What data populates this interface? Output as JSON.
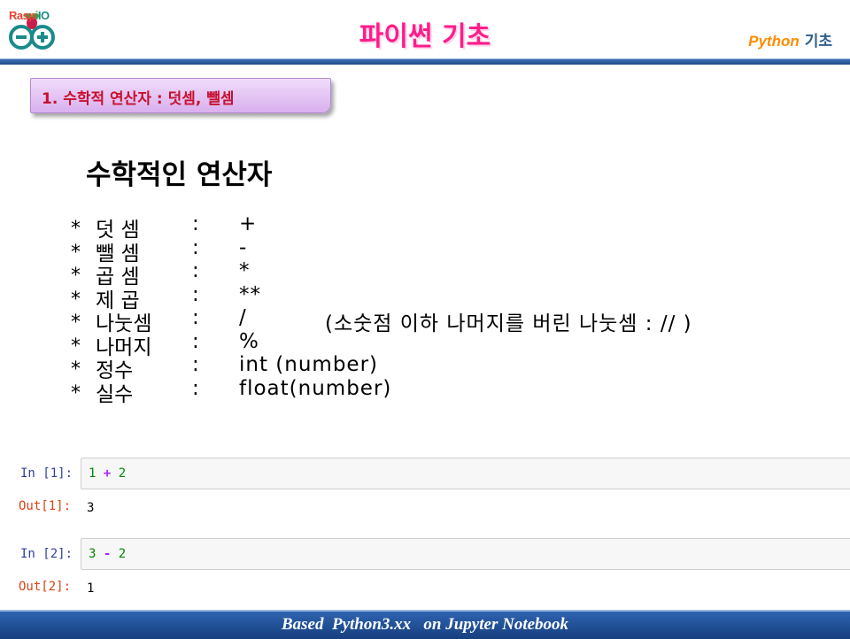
{
  "header": {
    "logo_text_a": "Rasp",
    "logo_text_b": "i",
    "logo_text_c": "IO",
    "title": "파이썬 기초",
    "subtitle_en": "Python",
    "subtitle_ko": "기초"
  },
  "section": {
    "label": "1. 수학적 연산자 : 덧셈, 뺄셈"
  },
  "content": {
    "heading": "수학적인 연산자",
    "operators": [
      {
        "bullet": "*",
        "name": "덧 셈",
        "colon": ":",
        "symbol": "+",
        "note": ""
      },
      {
        "bullet": "*",
        "name": "뺄 셈",
        "colon": ":",
        "symbol": "-",
        "note": ""
      },
      {
        "bullet": "*",
        "name": "곱 셈",
        "colon": ":",
        "symbol": "*",
        "note": ""
      },
      {
        "bullet": "*",
        "name": "제 곱",
        "colon": ":",
        "symbol": "**",
        "note": ""
      },
      {
        "bullet": "*",
        "name": "나눗셈",
        "colon": ":",
        "symbol": "/",
        "note": "(소숫점 이하 나머지를 버린 나눗셈 :  // )"
      },
      {
        "bullet": "*",
        "name": "나머지",
        "colon": ":",
        "symbol": "%",
        "note": ""
      },
      {
        "bullet": "*",
        "name": "정수",
        "colon": ":",
        "symbol": "int (number)",
        "note": ""
      },
      {
        "bullet": "*",
        "name": "실수",
        "colon": ":",
        "symbol": "float(number)",
        "note": ""
      }
    ]
  },
  "notebook": {
    "cells": [
      {
        "in_prompt": "In [1]:",
        "code_a": "1",
        "code_op": "+",
        "code_b": "2",
        "out_prompt": "Out[1]:",
        "output": "3"
      },
      {
        "in_prompt": "In [2]:",
        "code_a": "3",
        "code_op": "-",
        "code_b": "2",
        "out_prompt": "Out[2]:",
        "output": "1"
      }
    ]
  },
  "footer": {
    "text": "Based  Python3.xx   on Jupyter Notebook"
  },
  "colors": {
    "title": "#ff1c8a",
    "section_text": "#c8102e",
    "bar_blue": "#1e4a86",
    "in_prompt": "#303f9f",
    "out_prompt": "#d84315"
  }
}
